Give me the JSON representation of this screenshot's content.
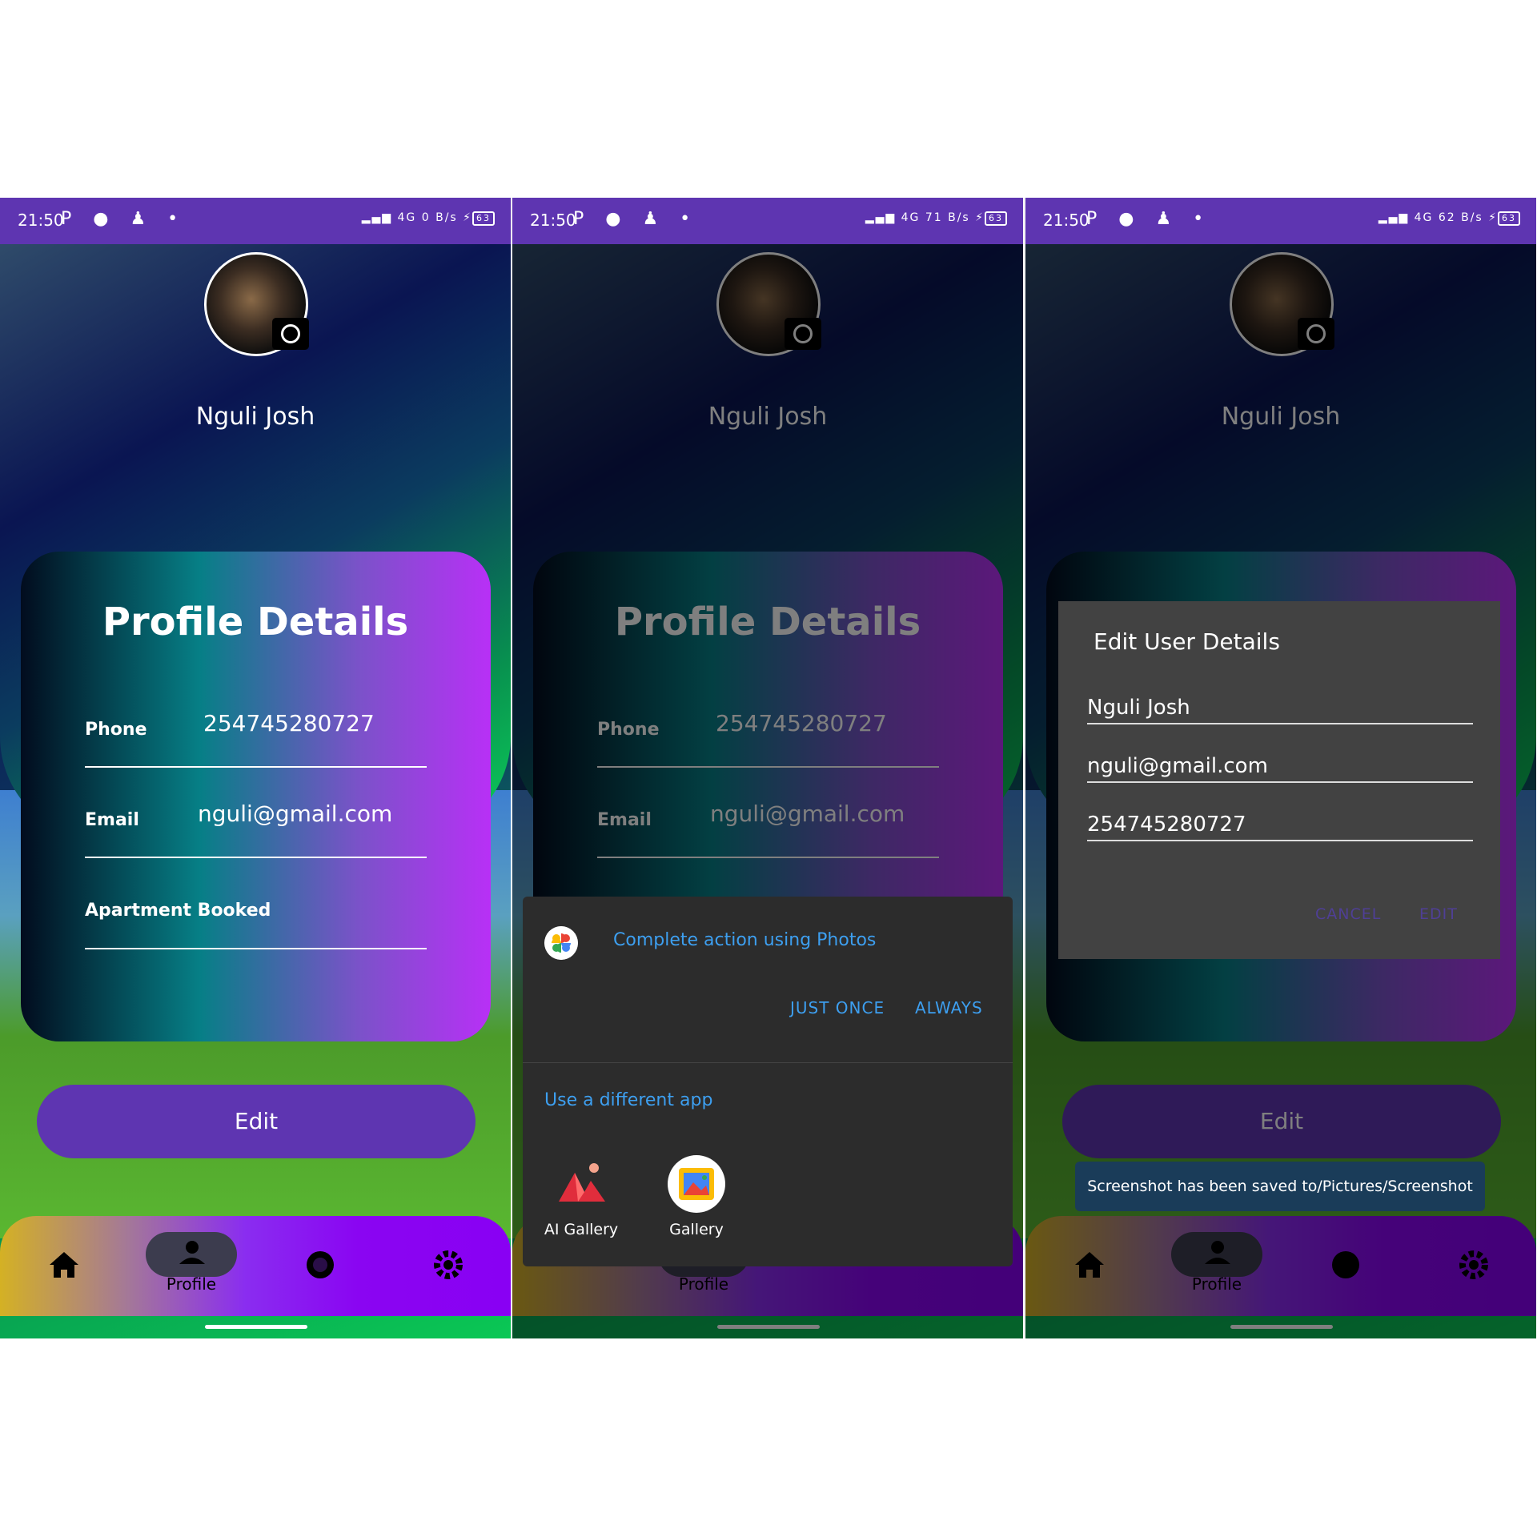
{
  "screens": [
    {
      "status": {
        "time": "21:50",
        "net_speed": "0 B/s",
        "network": "4G",
        "battery": "63"
      },
      "user": {
        "name": "Nguli Josh"
      },
      "card": {
        "title": "Profile Details",
        "phone_label": "Phone",
        "phone_value": "254745280727",
        "email_label": "Email",
        "email_value": "nguli@gmail.com",
        "apartment_label": "Apartment Booked"
      },
      "edit_button": "Edit",
      "nav": {
        "profile_label": "Profile"
      }
    },
    {
      "status": {
        "time": "21:50",
        "net_speed": "71 B/s",
        "network": "4G",
        "battery": "63"
      },
      "user": {
        "name": "Nguli Josh"
      },
      "card": {
        "title": "Profile Details",
        "phone_label": "Phone",
        "phone_value": "254745280727",
        "email_label": "Email",
        "email_value": "nguli@gmail.com"
      },
      "chooser": {
        "title": "Complete action using Photos",
        "just_once": "JUST ONCE",
        "always": "ALWAYS",
        "different_app": "Use a different app",
        "apps": [
          "AI Gallery",
          "Gallery"
        ]
      },
      "nav": {
        "profile_label": "Profile"
      }
    },
    {
      "status": {
        "time": "21:50",
        "net_speed": "62 B/s",
        "network": "4G",
        "battery": "63"
      },
      "user": {
        "name": "Nguli Josh"
      },
      "edit_dialog": {
        "title": "Edit User Details",
        "name_value": "Nguli Josh",
        "email_value": "nguli@gmail.com",
        "phone_value": "254745280727",
        "cancel": "CANCEL",
        "edit": "EDIT"
      },
      "edit_button": "Edit",
      "toast": "Screenshot has been saved to/Pictures/Screenshot",
      "nav": {
        "profile_label": "Profile"
      }
    }
  ],
  "colors": {
    "accent": "#5e35b1",
    "link_blue": "#3d9ff0",
    "nav_purple": "#8a05f2"
  },
  "icons": [
    "home-icon",
    "person-icon",
    "bell-icon",
    "gear-icon",
    "camera-icon"
  ]
}
